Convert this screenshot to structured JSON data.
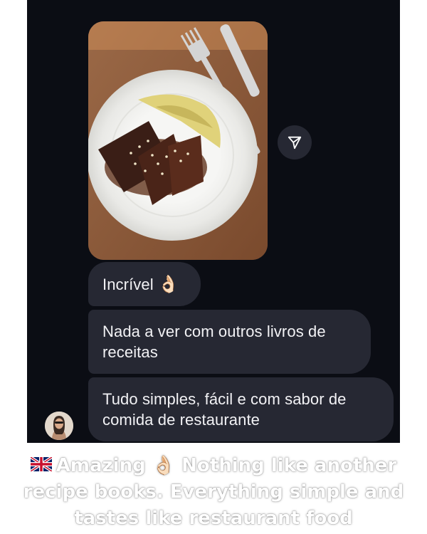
{
  "messages": [
    {
      "text": "Incrível",
      "emoji": "👌🏻"
    },
    {
      "text": "Nada a ver com outros livros de receitas"
    },
    {
      "text": "Tudo simples, fácil e com sabor de comida de restaurante"
    }
  ],
  "caption": {
    "flag": "uk-flag-icon",
    "text": "Amazing 👌🏻 Nothing like another recipe books. Everything simple and tastes like restaurant food"
  },
  "icons": {
    "share": "send-share-icon",
    "avatar": "user-avatar"
  },
  "colors": {
    "background": "#0b0d14",
    "bubble": "#262833",
    "text": "#f2f2f5"
  }
}
